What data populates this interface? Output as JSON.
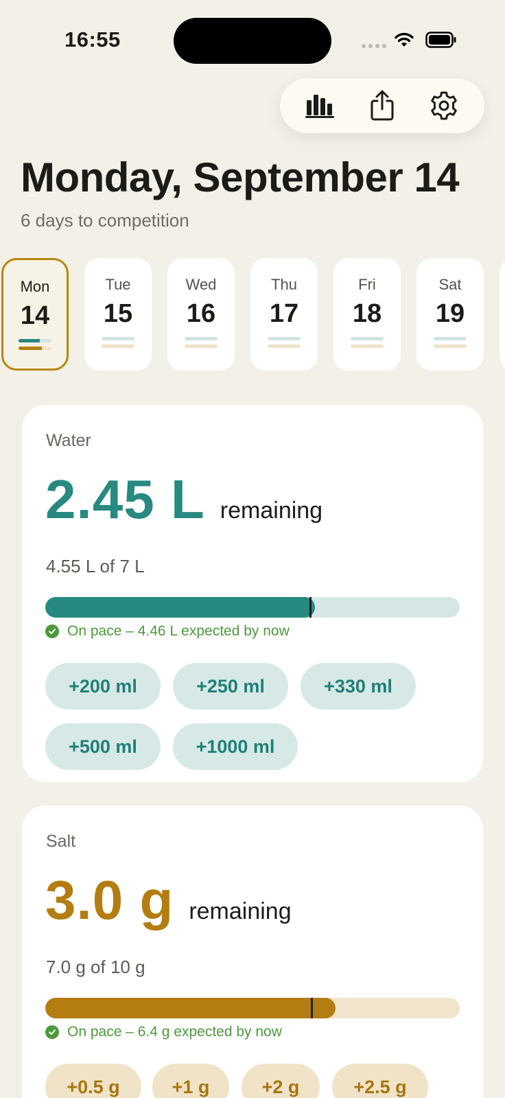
{
  "status_bar": {
    "time": "16:55"
  },
  "toolbar": {
    "icons": [
      "bar-chart-icon",
      "share-icon",
      "settings-gear-icon"
    ]
  },
  "header": {
    "title": "Monday, September 14",
    "subtitle": "6 days to competition"
  },
  "days": [
    {
      "name": "Mon",
      "num": "14",
      "selected": true,
      "water_progress": 0.65,
      "salt_progress": 0.7
    },
    {
      "name": "Tue",
      "num": "15",
      "selected": false,
      "water_progress": 0,
      "salt_progress": 0
    },
    {
      "name": "Wed",
      "num": "16",
      "selected": false,
      "water_progress": 0,
      "salt_progress": 0
    },
    {
      "name": "Thu",
      "num": "17",
      "selected": false,
      "water_progress": 0,
      "salt_progress": 0
    },
    {
      "name": "Fri",
      "num": "18",
      "selected": false,
      "water_progress": 0,
      "salt_progress": 0
    },
    {
      "name": "Sat",
      "num": "19",
      "selected": false,
      "water_progress": 0,
      "salt_progress": 0
    }
  ],
  "water": {
    "label": "Water",
    "remaining": "2.45 L",
    "remaining_suffix": "remaining",
    "amount": "4.55 L of 7 L",
    "progress": 0.65,
    "expected_marker": 0.637,
    "pace_text": "On pace – 4.46 L expected by now",
    "accent": "#27897f",
    "track": "#d4e7e6",
    "chips": [
      "+200 ml",
      "+250 ml",
      "+330 ml",
      "+500 ml",
      "+1000 ml"
    ]
  },
  "salt": {
    "label": "Salt",
    "remaining": "3.0 g",
    "remaining_suffix": "remaining",
    "amount": "7.0 g of 10 g",
    "progress": 0.7,
    "expected_marker": 0.64,
    "pace_text": "On pace – 6.4 g expected by now",
    "accent": "#b47d11",
    "track": "#f0e4cc",
    "chips": [
      "+0.5 g",
      "+1 g",
      "+2 g",
      "+2.5 g"
    ]
  }
}
